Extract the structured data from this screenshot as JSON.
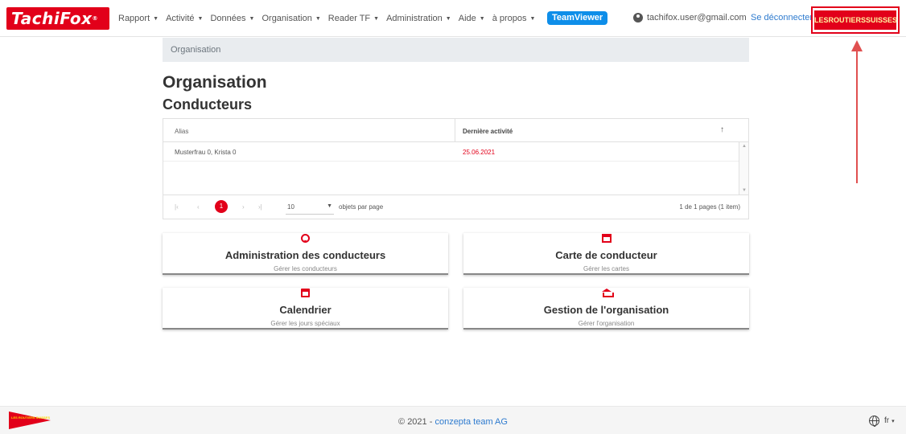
{
  "navbar": {
    "logo_text": "TachiFox",
    "logo_mark": "®",
    "menu": [
      {
        "label": "Rapport"
      },
      {
        "label": "Activité"
      },
      {
        "label": "Données"
      },
      {
        "label": "Organisation"
      },
      {
        "label": "Reader TF"
      },
      {
        "label": "Administration"
      },
      {
        "label": "Aide"
      },
      {
        "label": "à propos"
      }
    ],
    "caret": "▼",
    "teamviewer": "TeamViewer",
    "user_email": "tachifox.user@gmail.com",
    "logout": "Se déconnecter",
    "organization": "LESROUTIERSSUISSES"
  },
  "breadcrumb": "Organisation",
  "page_title": "Organisation",
  "section_title": "Conducteurs",
  "grid": {
    "columns": [
      "Alias",
      "Dernière activité"
    ],
    "sort_icon": "↑",
    "rows": [
      {
        "alias": "Musterfrau 0, Krista 0",
        "last_activity": "25.06.2021"
      }
    ],
    "pager": {
      "first": "|‹",
      "prev": "‹",
      "current_page": "1",
      "next": "›",
      "last": "›|",
      "page_size": "10",
      "per_page_label": "objets par page",
      "info": "1 de 1 pages (1 item)"
    }
  },
  "cards": [
    {
      "icon": "face-icon",
      "title": "Administration des conducteurs",
      "subtitle": "Gérer les conducteurs"
    },
    {
      "icon": "card-icon",
      "title": "Carte de conducteur",
      "subtitle": "Gérer les cartes"
    },
    {
      "icon": "calendar-icon",
      "title": "Calendrier",
      "subtitle": "Gérer les jours spéciaux"
    },
    {
      "icon": "bank-icon",
      "title": "Gestion de l'organisation",
      "subtitle": "Gérer l'organisation"
    }
  ],
  "footer": {
    "logo_text": "LES ROUTIERS SUISSES",
    "copyright_prefix": "© 2021 - ",
    "company": "conzepta team AG",
    "language": "fr"
  },
  "colors": {
    "brand_red": "#e2001a",
    "link_blue": "#2e7bcf",
    "teamviewer_blue": "#0e8ee9"
  }
}
